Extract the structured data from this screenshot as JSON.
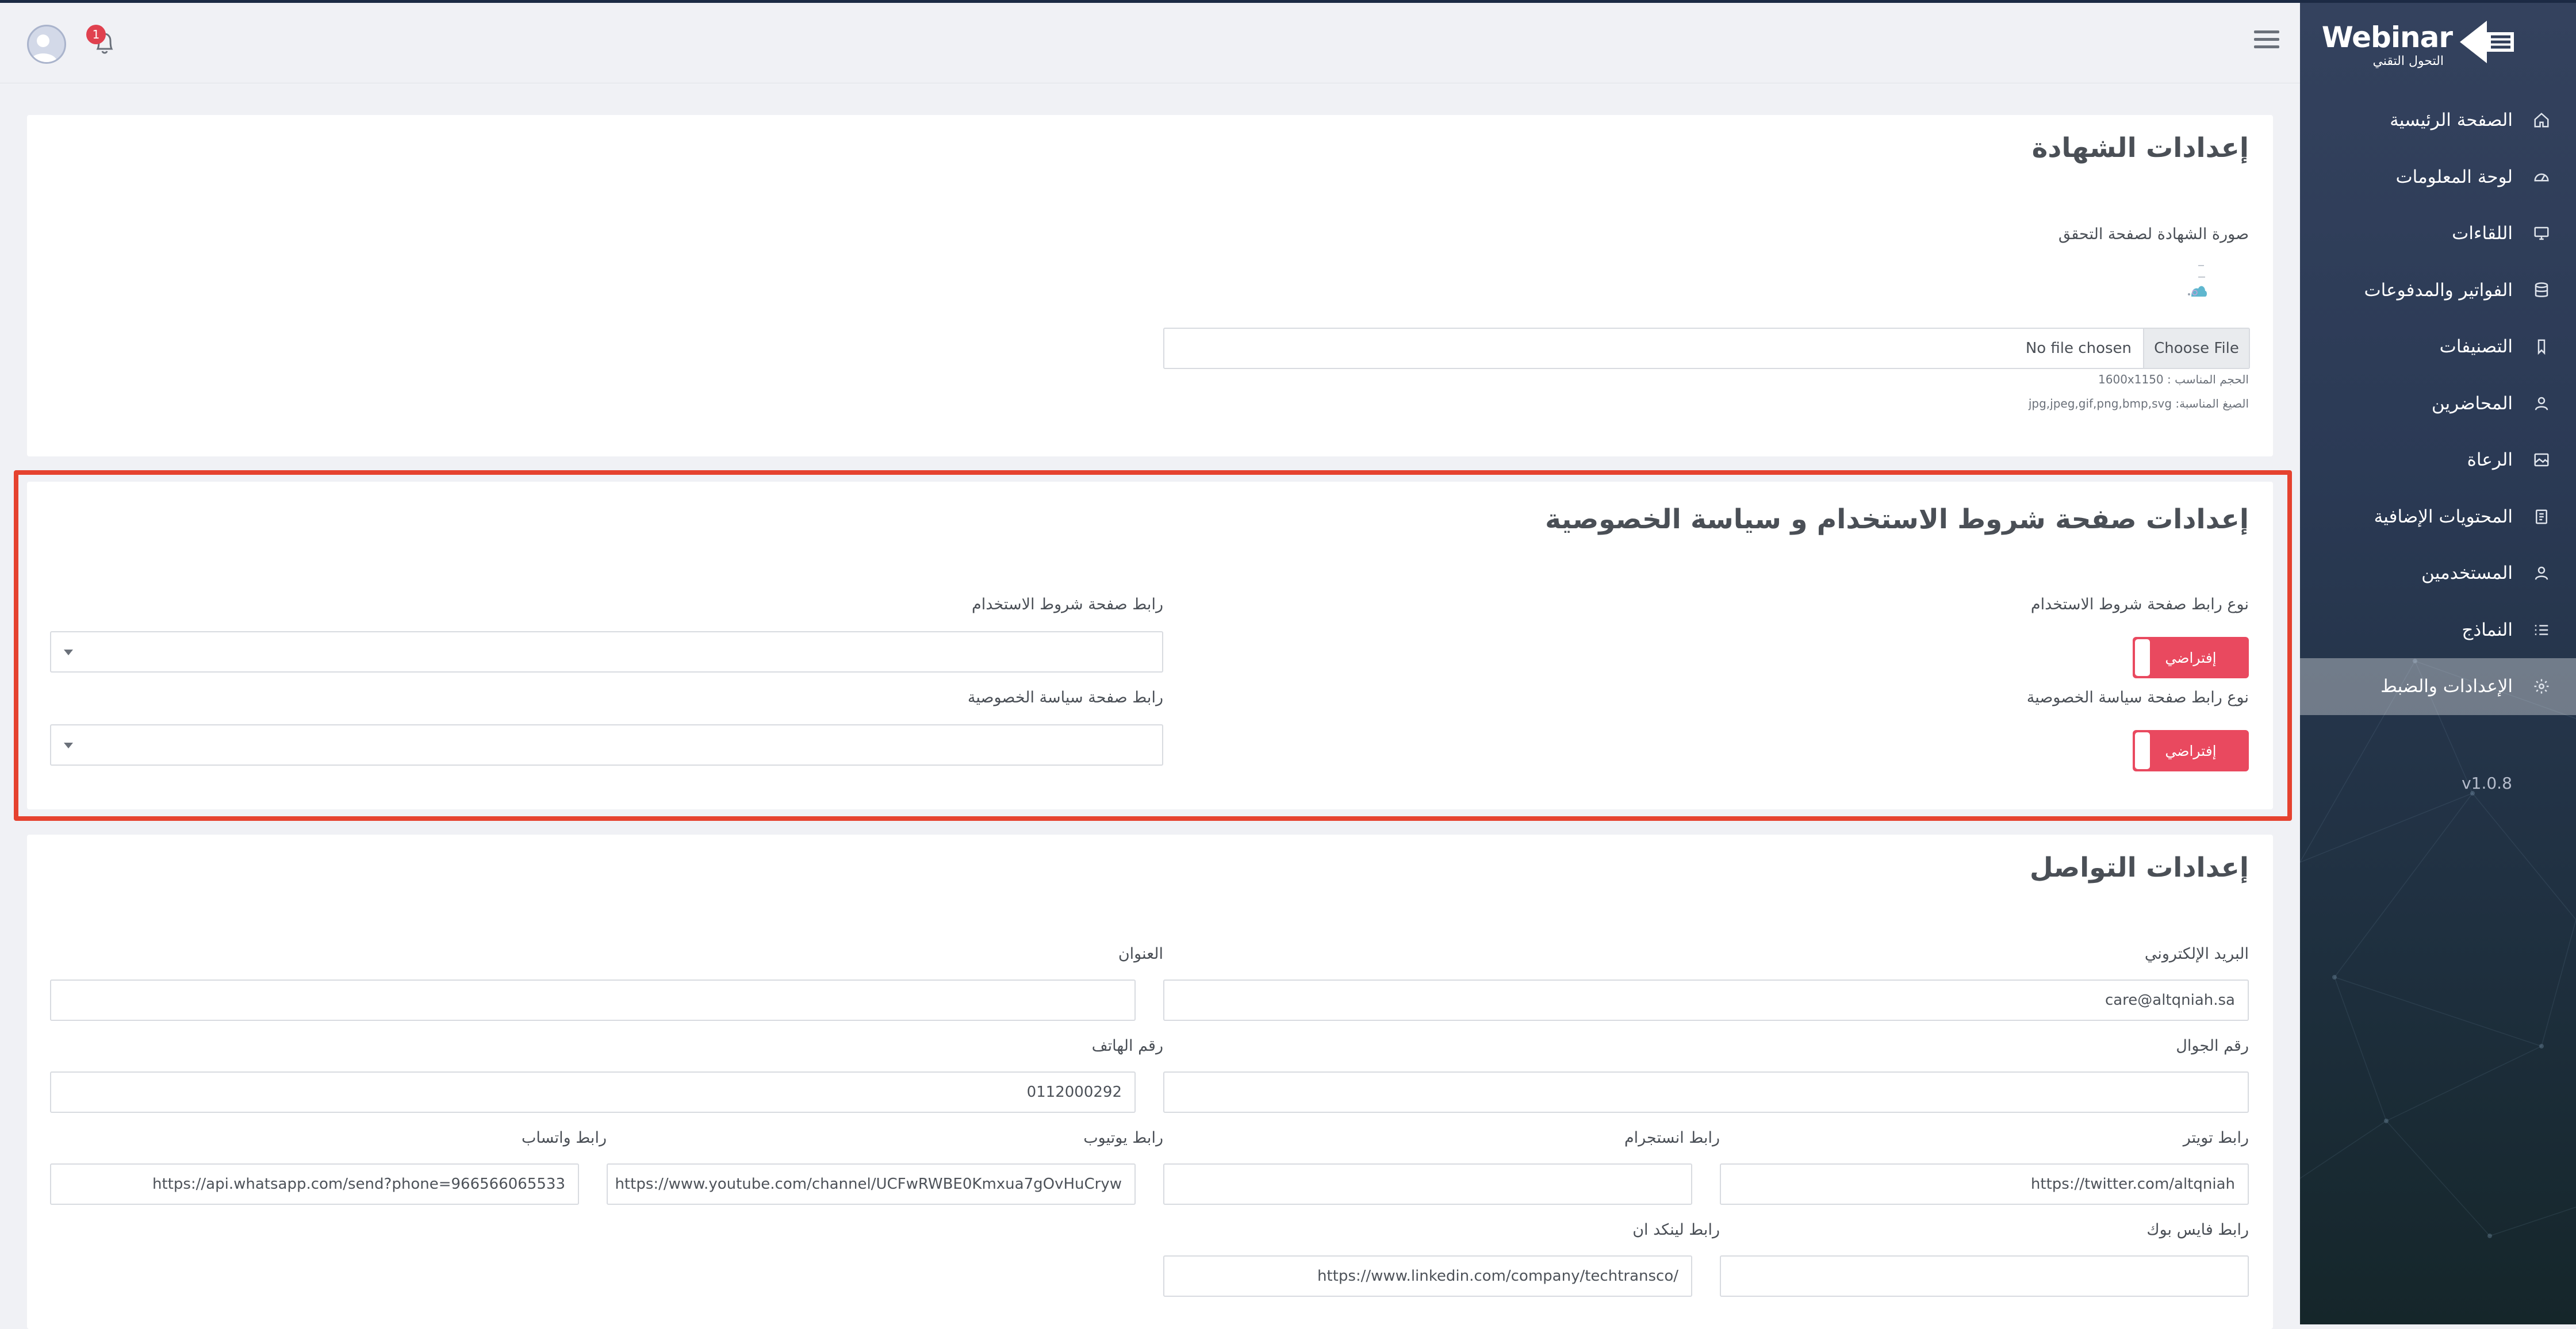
{
  "app": {
    "logo_text": "Webinar",
    "logo_subtext": "التحول التقني",
    "version": "v1.0.8",
    "notification_count": "1"
  },
  "sidebar": {
    "items": [
      {
        "label": "الصفحة الرئيسية",
        "icon": "home-icon"
      },
      {
        "label": "لوحة المعلومات",
        "icon": "dashboard-gauge-icon"
      },
      {
        "label": "اللقاءات",
        "icon": "monitor-icon"
      },
      {
        "label": "الفواتير والمدفوعات",
        "icon": "database-icon"
      },
      {
        "label": "التصنيفات",
        "icon": "tag-icon"
      },
      {
        "label": "المحاضرين",
        "icon": "user-icon"
      },
      {
        "label": "الرعاة",
        "icon": "image-icon"
      },
      {
        "label": "المحتويات الإضافية",
        "icon": "document-icon"
      },
      {
        "label": "المستخدمين",
        "icon": "user-icon"
      },
      {
        "label": "النماذج",
        "icon": "list-icon"
      },
      {
        "label": "الإعدادات والضبط",
        "icon": "gear-icon",
        "active": true
      }
    ]
  },
  "certificate": {
    "title": "إعدادات الشهادة",
    "image_label": "صورة الشهادة لصفحة التحقق",
    "choose_file": "Choose File",
    "no_file": "No file chosen",
    "size_hint": "الحجم المناسب : 1600x1150",
    "format_hint": "الصيغ المناسبة: jpg,jpeg,gif,png,bmp,svg"
  },
  "terms": {
    "title": "إعدادات صفحة شروط الاستخدام و سياسة الخصوصية",
    "terms_type_label": "نوع رابط صفحة شروط الاستخدام",
    "terms_type_value": "إفتراضي",
    "privacy_type_label": "نوع رابط صفحة سياسة الخصوصية",
    "privacy_type_value": "إفتراضي",
    "terms_link_label": "رابط صفحة شروط الاستخدام",
    "privacy_link_label": "رابط صفحة سياسة الخصوصية"
  },
  "contact": {
    "title": "إعدادات التواصل",
    "email_label": "البريد الإلكتروني",
    "email_value": "care@altqniah.sa",
    "address_label": "العنوان",
    "address_value": "",
    "mobile_label": "رقم الجوال",
    "mobile_value": "",
    "phone_label": "رقم الهاتف",
    "phone_value": "0112000292",
    "twitter_label": "رابط تويتر",
    "twitter_value": "https://twitter.com/altqniah",
    "instagram_label": "رابط انستجرام",
    "instagram_value": "",
    "youtube_label": "رابط يوتيوب",
    "youtube_value": "https://www.youtube.com/channel/UCFwRWBE0Kmxua7gOvHuCryw",
    "whatsapp_label": "رابط واتساب",
    "whatsapp_value": "https://api.whatsapp.com/send?phone=966566065533",
    "facebook_label": "رابط فايس بوك",
    "facebook_value": "",
    "linkedin_label": "رابط لينكد ان",
    "linkedin_value": "https://www.linkedin.com/company/techtransco/"
  },
  "colors": {
    "accent_red": "#e9495f",
    "highlight_border": "#e5422f",
    "sidebar_bg": "#2b3a55",
    "badge": "#e0414f"
  }
}
